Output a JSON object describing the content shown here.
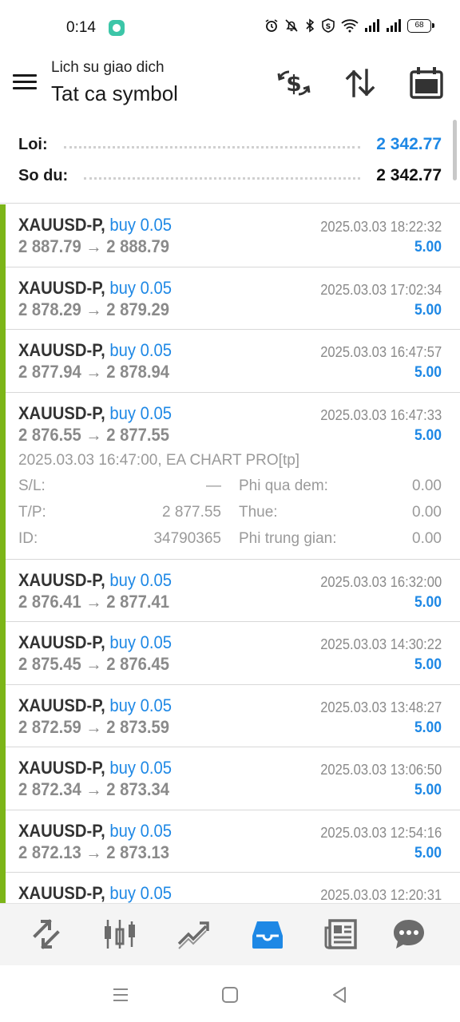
{
  "status_bar": {
    "time": "0:14",
    "battery": "68"
  },
  "header": {
    "subtitle": "Lich su giao dich",
    "title": "Tat ca symbol"
  },
  "summary": {
    "profit_label": "Loi:",
    "profit_value": "2 342.77",
    "balance_label": "So du:",
    "balance_value": "2 342.77"
  },
  "colors": {
    "accent_blue": "#1e88e5",
    "buy_bar_green": "#7cb518",
    "muted_gray": "#8a8a8a"
  },
  "deals": [
    {
      "symbol": "XAUUSD-P,",
      "side": "buy 0.05",
      "time": "2025.03.03 18:22:32",
      "prices": "2 887.79 → 2 888.79",
      "profit": "5.00"
    },
    {
      "symbol": "XAUUSD-P,",
      "side": "buy 0.05",
      "time": "2025.03.03 17:02:34",
      "prices": "2 878.29 → 2 879.29",
      "profit": "5.00"
    },
    {
      "symbol": "XAUUSD-P,",
      "side": "buy 0.05",
      "time": "2025.03.03 16:47:57",
      "prices": "2 877.94 → 2 878.94",
      "profit": "5.00"
    },
    {
      "symbol": "XAUUSD-P,",
      "side": "buy 0.05",
      "time": "2025.03.03 16:47:33",
      "prices": "2 876.55 → 2 877.55",
      "profit": "5.00"
    },
    {
      "symbol": "XAUUSD-P,",
      "side": "buy 0.05",
      "time": "2025.03.03 16:32:00",
      "prices": "2 876.41 → 2 877.41",
      "profit": "5.00"
    },
    {
      "symbol": "XAUUSD-P,",
      "side": "buy 0.05",
      "time": "2025.03.03 14:30:22",
      "prices": "2 875.45 → 2 876.45",
      "profit": "5.00"
    },
    {
      "symbol": "XAUUSD-P,",
      "side": "buy 0.05",
      "time": "2025.03.03 13:48:27",
      "prices": "2 872.59 → 2 873.59",
      "profit": "5.00"
    },
    {
      "symbol": "XAUUSD-P,",
      "side": "buy 0.05",
      "time": "2025.03.03 13:06:50",
      "prices": "2 872.34 → 2 873.34",
      "profit": "5.00"
    },
    {
      "symbol": "XAUUSD-P,",
      "side": "buy 0.05",
      "time": "2025.03.03 12:54:16",
      "prices": "2 872.13 → 2 873.13",
      "profit": "5.00"
    },
    {
      "symbol": "XAUUSD-P,",
      "side": "buy 0.05",
      "time": "2025.03.03 12:20:31",
      "prices": "",
      "profit": ""
    }
  ],
  "expanded_details": {
    "open_line": "2025.03.03 16:47:00, EA CHART PRO[tp]",
    "sl_label": "S/L:",
    "sl_value": "—",
    "tp_label": "T/P:",
    "tp_value": "2 877.55",
    "id_label": "ID:",
    "id_value": "34790365",
    "swap_label": "Phi qua dem:",
    "swap_value": "0.00",
    "tax_label": "Thue:",
    "tax_value": "0.00",
    "commission_label": "Phi trung gian:",
    "commission_value": "0.00"
  },
  "tabbar": {
    "items": [
      "quotes-icon",
      "chart-icon",
      "trade-icon",
      "history-icon",
      "news-icon",
      "chat-icon"
    ],
    "active": "history-icon"
  }
}
